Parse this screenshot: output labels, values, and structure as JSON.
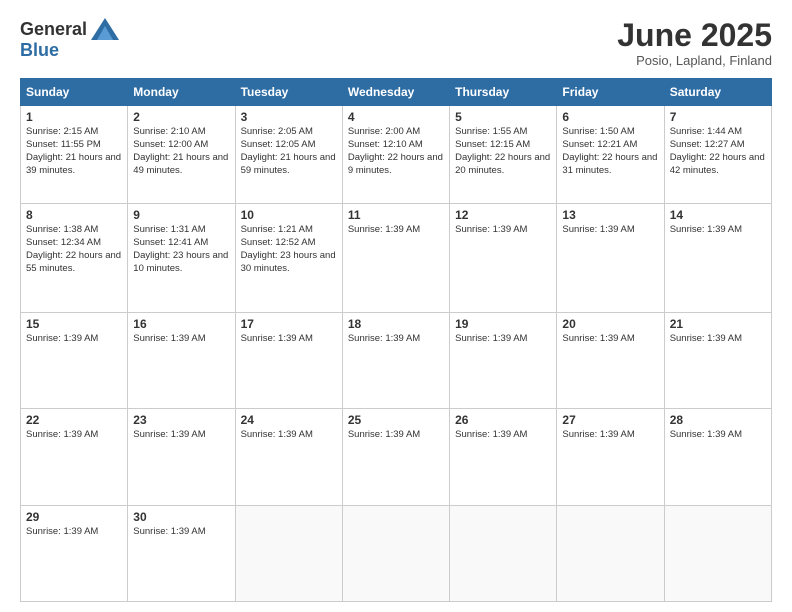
{
  "header": {
    "logo_general": "General",
    "logo_blue": "Blue",
    "month_year": "June 2025",
    "location": "Posio, Lapland, Finland"
  },
  "days_of_week": [
    "Sunday",
    "Monday",
    "Tuesday",
    "Wednesday",
    "Thursday",
    "Friday",
    "Saturday"
  ],
  "weeks": [
    [
      {
        "day": "1",
        "info": "Sunrise: 2:15 AM\nSunset: 11:55 PM\nDaylight: 21 hours\nand 39 minutes."
      },
      {
        "day": "2",
        "info": "Sunrise: 2:10 AM\nSunset: 12:00 AM\nDaylight: 21 hours\nand 49 minutes."
      },
      {
        "day": "3",
        "info": "Sunrise: 2:05 AM\nSunset: 12:05 AM\nDaylight: 21 hours\nand 59 minutes."
      },
      {
        "day": "4",
        "info": "Sunrise: 2:00 AM\nSunset: 12:10 AM\nDaylight: 22 hours\nand 9 minutes."
      },
      {
        "day": "5",
        "info": "Sunrise: 1:55 AM\nSunset: 12:15 AM\nDaylight: 22 hours\nand 20 minutes."
      },
      {
        "day": "6",
        "info": "Sunrise: 1:50 AM\nSunset: 12:21 AM\nDaylight: 22 hours\nand 31 minutes."
      },
      {
        "day": "7",
        "info": "Sunrise: 1:44 AM\nSunset: 12:27 AM\nDaylight: 22 hours\nand 42 minutes."
      }
    ],
    [
      {
        "day": "8",
        "info": "Sunrise: 1:38 AM\nSunset: 12:34 AM\nDaylight: 22 hours\nand 55 minutes."
      },
      {
        "day": "9",
        "info": "Sunrise: 1:31 AM\nSunset: 12:41 AM\nDaylight: 23 hours\nand 10 minutes."
      },
      {
        "day": "10",
        "info": "Sunrise: 1:21 AM\nSunset: 12:52 AM\nDaylight: 23 hours\nand 30 minutes."
      },
      {
        "day": "11",
        "info": "Sunrise: 1:39 AM"
      },
      {
        "day": "12",
        "info": "Sunrise: 1:39 AM"
      },
      {
        "day": "13",
        "info": "Sunrise: 1:39 AM"
      },
      {
        "day": "14",
        "info": "Sunrise: 1:39 AM"
      }
    ],
    [
      {
        "day": "15",
        "info": "Sunrise: 1:39 AM"
      },
      {
        "day": "16",
        "info": "Sunrise: 1:39 AM"
      },
      {
        "day": "17",
        "info": "Sunrise: 1:39 AM"
      },
      {
        "day": "18",
        "info": "Sunrise: 1:39 AM"
      },
      {
        "day": "19",
        "info": "Sunrise: 1:39 AM"
      },
      {
        "day": "20",
        "info": "Sunrise: 1:39 AM"
      },
      {
        "day": "21",
        "info": "Sunrise: 1:39 AM"
      }
    ],
    [
      {
        "day": "22",
        "info": "Sunrise: 1:39 AM"
      },
      {
        "day": "23",
        "info": "Sunrise: 1:39 AM"
      },
      {
        "day": "24",
        "info": "Sunrise: 1:39 AM"
      },
      {
        "day": "25",
        "info": "Sunrise: 1:39 AM"
      },
      {
        "day": "26",
        "info": "Sunrise: 1:39 AM"
      },
      {
        "day": "27",
        "info": "Sunrise: 1:39 AM"
      },
      {
        "day": "28",
        "info": "Sunrise: 1:39 AM"
      }
    ],
    [
      {
        "day": "29",
        "info": "Sunrise: 1:39 AM"
      },
      {
        "day": "30",
        "info": "Sunrise: 1:39 AM"
      },
      {
        "day": "",
        "info": ""
      },
      {
        "day": "",
        "info": ""
      },
      {
        "day": "",
        "info": ""
      },
      {
        "day": "",
        "info": ""
      },
      {
        "day": "",
        "info": ""
      }
    ]
  ]
}
